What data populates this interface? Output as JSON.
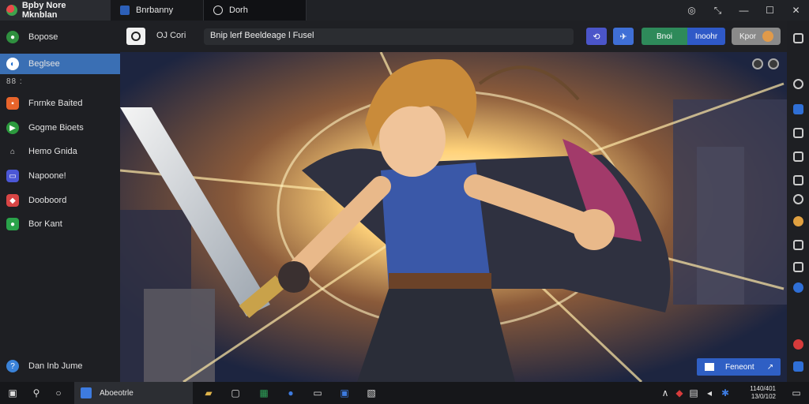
{
  "titlebar": {
    "app_title": "Bpby Nore Mknblan",
    "tabs": [
      {
        "label": "Bnrbanny"
      },
      {
        "label": "Dorh"
      }
    ]
  },
  "sidebar": {
    "items": [
      {
        "label": "Bopose",
        "icon": "globe-icon",
        "color": "#2f8f3f"
      },
      {
        "label": "Beglsee",
        "icon": "bluestacks-icon",
        "color": "#1f6fd0"
      },
      {
        "label": "Fnrnke Baited",
        "icon": "store-icon",
        "color": "#e8642b"
      },
      {
        "label": "Gogme Bioets",
        "icon": "google-play-icon",
        "color": "#2c9a3e"
      },
      {
        "label": "Hemo Gnida",
        "icon": "home-icon",
        "color": "#cfcfcf"
      },
      {
        "label": "Napoone!",
        "icon": "video-icon",
        "color": "#4b57d6"
      },
      {
        "label": "Dooboord",
        "icon": "gamepad-icon",
        "color": "#d84545"
      },
      {
        "label": "Bor Kant",
        "icon": "android-icon",
        "color": "#2aa34a"
      },
      {
        "label": "Dan Inb Jume",
        "icon": "help-icon",
        "color": "#3a82d8"
      }
    ],
    "sub_label": "88 :"
  },
  "toolbar": {
    "label_left": "OJ  Cori",
    "address": "Bnip lerf Beeldeage  l Fusel",
    "btn_a": "⟲",
    "btn_b": "✈",
    "split_left": "Bnoi",
    "split_right": "Inoohr",
    "pill_label": "Kpor"
  },
  "viewport": {
    "reward_label": "Feneont"
  },
  "taskbar": {
    "active_app": "Aboeotrle",
    "clock_time": "1140/401",
    "clock_date": "13/0/102"
  },
  "colors": {
    "accent": "#3a6fb4",
    "rail_red": "#d63b3b",
    "rail_blue": "#2f6fd6"
  }
}
